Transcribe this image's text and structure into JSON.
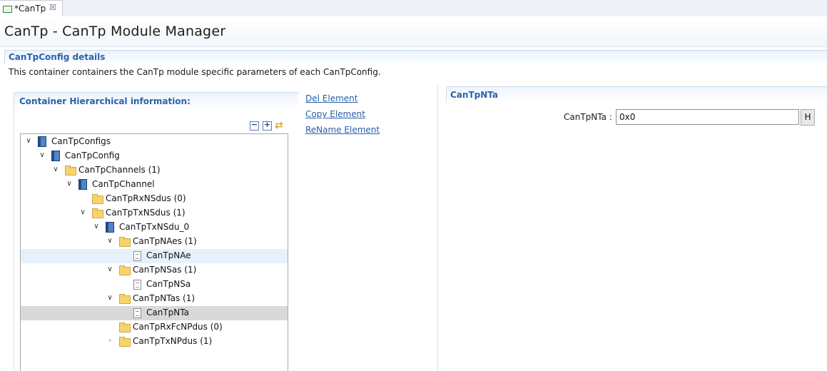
{
  "tab": {
    "label": "*CanTp",
    "close_glyph": "☒"
  },
  "header": {
    "title": "CanTp - CanTp Module Manager"
  },
  "details": {
    "title": "CanTpConfig details",
    "description": "This container containers the CanTp module specific parameters of each CanTpConfig."
  },
  "hierarchy": {
    "title": "Container Hierarchical information:",
    "toolbar": {
      "collapse_glyph": "−",
      "expand_glyph": "+",
      "sync_glyph": "⇄"
    },
    "tree": [
      {
        "label": "CanTpConfigs",
        "level": 0,
        "icon": "module-icon",
        "toggle": "open"
      },
      {
        "label": "CanTpConfig",
        "level": 1,
        "icon": "module-icon",
        "toggle": "open"
      },
      {
        "label": "CanTpChannels (1)",
        "level": 2,
        "icon": "folder-icon",
        "toggle": "open"
      },
      {
        "label": "CanTpChannel",
        "level": 3,
        "icon": "module-icon",
        "toggle": "open"
      },
      {
        "label": "CanTpRxNSdus (0)",
        "level": 4,
        "icon": "folder-icon",
        "toggle": "none"
      },
      {
        "label": "CanTpTxNSdus (1)",
        "level": 4,
        "icon": "folder-icon",
        "toggle": "open"
      },
      {
        "label": "CanTpTxNSdu_0",
        "level": 5,
        "icon": "module-icon",
        "toggle": "open"
      },
      {
        "label": "CanTpNAes (1)",
        "level": 6,
        "icon": "folder-icon",
        "toggle": "open"
      },
      {
        "label": "CanTpNAe",
        "level": 7,
        "icon": "document-icon",
        "toggle": "none",
        "state": "hover"
      },
      {
        "label": "CanTpNSas (1)",
        "level": 6,
        "icon": "folder-icon",
        "toggle": "open"
      },
      {
        "label": "CanTpNSa",
        "level": 7,
        "icon": "document-icon",
        "toggle": "none"
      },
      {
        "label": "CanTpNTas (1)",
        "level": 6,
        "icon": "folder-icon",
        "toggle": "open"
      },
      {
        "label": "CanTpNTa",
        "level": 7,
        "icon": "document-icon",
        "toggle": "none",
        "state": "selected"
      },
      {
        "label": "CanTpRxFcNPdus (0)",
        "level": 6,
        "icon": "folder-icon",
        "toggle": "none"
      },
      {
        "label": "CanTpTxNPdus (1)",
        "level": 6,
        "icon": "folder-icon",
        "toggle": "closed"
      }
    ]
  },
  "actions": {
    "delete": "Del Element",
    "copy": "Copy Element",
    "rename": "ReName Element"
  },
  "parameter": {
    "section_title": "CanTpNTa",
    "field_label": "CanTpNTa :",
    "field_value": "0x0",
    "help_button": "H"
  },
  "colors": {
    "accent": "#2a62a9",
    "link": "#2a5ea8",
    "selection": "#d9d9d9",
    "hover": "#e5f1fb"
  }
}
